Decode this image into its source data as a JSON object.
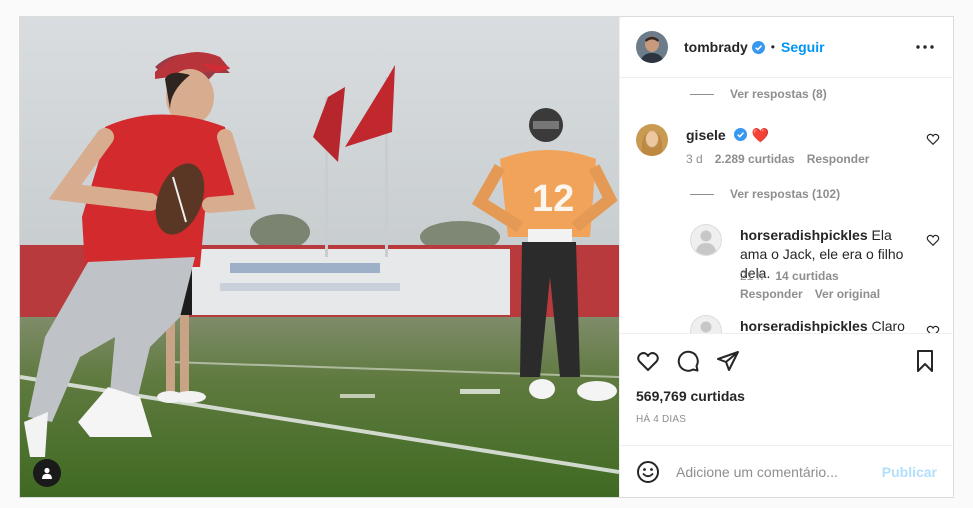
{
  "post": {
    "author": {
      "username": "tombrady",
      "verified": true,
      "follow_label": "Seguir",
      "separator": "•"
    },
    "image": {
      "alt": ""
    },
    "actions": {
      "like_icon": "heart-icon",
      "comment_icon": "comment-icon",
      "share_icon": "paper-plane-icon",
      "save_icon": "bookmark-icon"
    },
    "likes": "569,769 curtidas",
    "date": "HÁ 4 DIAS"
  },
  "comments": {
    "top_view_replies": "Ver respostas (8)",
    "items": [
      {
        "username": "gisele",
        "verified": true,
        "text": "❤️",
        "time": "3 d",
        "likes": "2.289 curtidas",
        "reply_label": "Responder",
        "view_replies": "Ver respostas (102)"
      },
      {
        "username": "horseradishpickles",
        "text": "Ela ama o Jack, ele era o filho dela.",
        "time": "21 h",
        "likes": "14 curtidas",
        "reply_label": "Responder",
        "see_original": "Ver original"
      },
      {
        "username": "horseradishpickles",
        "text": "Claro"
      }
    ]
  },
  "add_comment": {
    "placeholder": "Adicione um comentário...",
    "publish_label": "Publicar"
  },
  "colors": {
    "accent": "#0095f6",
    "verified": "#3897f0",
    "heart_red": "#ed4956",
    "publish_disabled": "#b2dffc"
  }
}
